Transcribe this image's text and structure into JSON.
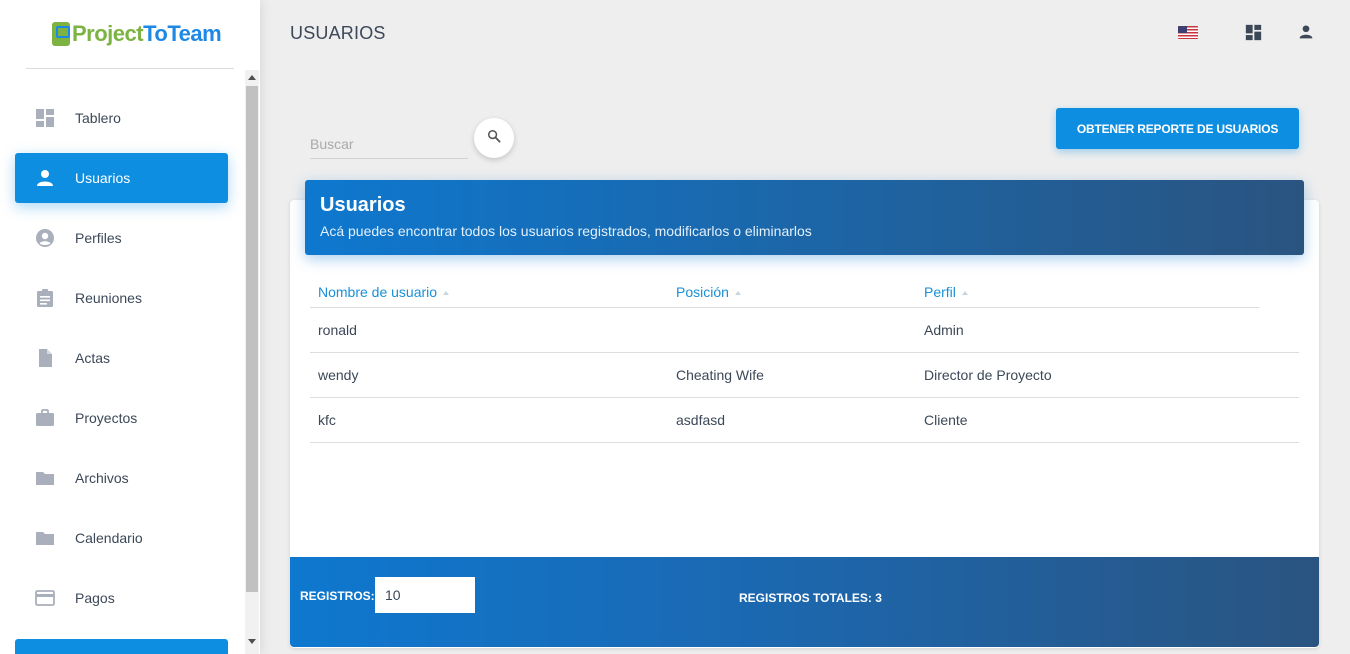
{
  "app": {
    "logo_text_part1": "Project",
    "logo_text_part2": "ToTeam"
  },
  "header": {
    "title": "USUARIOS",
    "language_icon": "us-flag-icon",
    "dashboard_icon": "dashboard-icon",
    "account_icon": "person-icon"
  },
  "sidebar": {
    "items": [
      {
        "label": "Tablero",
        "icon": "dashboard-icon",
        "active": false
      },
      {
        "label": "Usuarios",
        "icon": "person-icon",
        "active": true
      },
      {
        "label": "Perfiles",
        "icon": "account-circle-icon",
        "active": false
      },
      {
        "label": "Reuniones",
        "icon": "assignment-icon",
        "active": false
      },
      {
        "label": "Actas",
        "icon": "document-icon",
        "active": false
      },
      {
        "label": "Proyectos",
        "icon": "briefcase-icon",
        "active": false
      },
      {
        "label": "Archivos",
        "icon": "folder-icon",
        "active": false
      },
      {
        "label": "Calendario",
        "icon": "folder-icon",
        "active": false
      },
      {
        "label": "Pagos",
        "icon": "credit-card-icon",
        "active": false
      }
    ]
  },
  "search": {
    "placeholder": "Buscar",
    "value": ""
  },
  "actions": {
    "report_button": "OBTENER REPORTE DE USUARIOS"
  },
  "card": {
    "title": "Usuarios",
    "subtitle": "Acá puedes encontrar todos los usuarios registrados, modificarlos o eliminarlos"
  },
  "table": {
    "columns": [
      "Nombre de usuario",
      "Posición",
      "Perfil"
    ],
    "rows": [
      [
        "ronald",
        "",
        "Admin"
      ],
      [
        "wendy",
        "Cheating Wife",
        "Director de Proyecto"
      ],
      [
        "kfc",
        "asdfasd",
        "Cliente"
      ]
    ]
  },
  "footer": {
    "records_label": "REGISTROS:",
    "records_value": "10",
    "total_label": "REGISTROS TOTALES: 3"
  },
  "colors": {
    "accent": "#0e8ee0",
    "header_gradient_end": "#2a5480",
    "text": "#3c4858"
  }
}
